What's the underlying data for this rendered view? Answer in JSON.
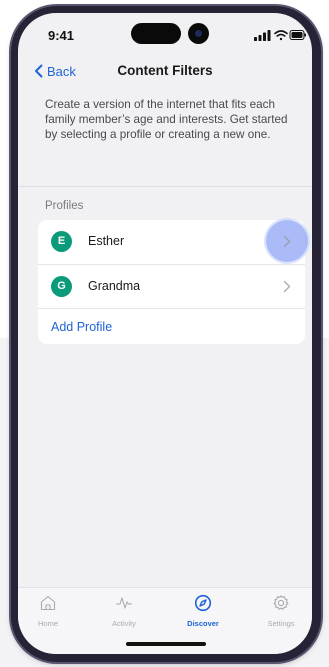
{
  "status_bar": {
    "time": "9:41"
  },
  "nav": {
    "back_label": "Back",
    "title": "Content Filters"
  },
  "description": "Create a version of the internet that fits each family member’s age and interests. Get started by selecting a profile or creating a new one.",
  "profiles": {
    "header": "Profiles",
    "items": [
      {
        "initial": "E",
        "name": "Esther"
      },
      {
        "initial": "G",
        "name": "Grandma"
      }
    ],
    "add_label": "Add Profile"
  },
  "tabs": [
    {
      "label": "Home",
      "icon": "home-icon"
    },
    {
      "label": "Activity",
      "icon": "activity-icon"
    },
    {
      "label": "Discover",
      "icon": "compass-icon",
      "active": true
    },
    {
      "label": "Settings",
      "icon": "gear-icon"
    }
  ],
  "colors": {
    "accent": "#1f63d6",
    "avatar": "#0b9a7a",
    "highlight": "#96aaf5"
  }
}
